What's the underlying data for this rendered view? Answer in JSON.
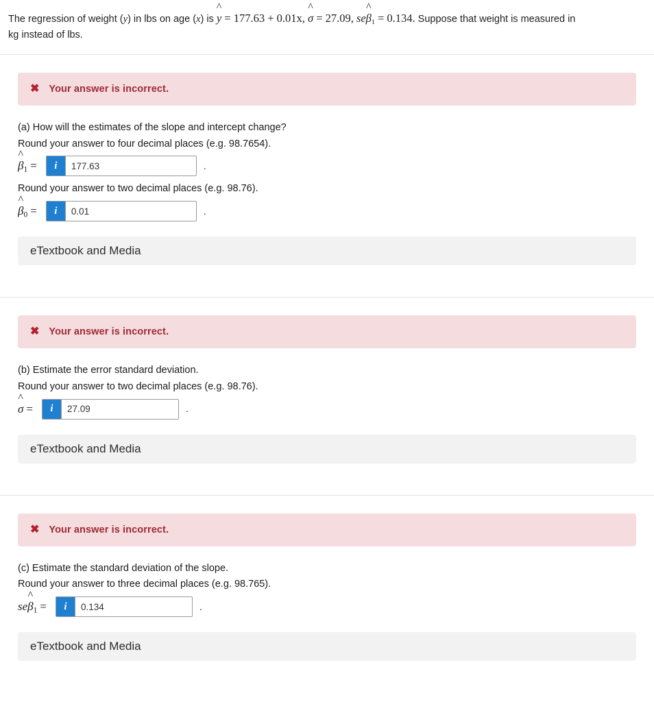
{
  "prompt": {
    "part1": "The regression of weight (",
    "y_var": "y",
    "part2": ") in lbs on age (",
    "x_var": "x",
    "part3": ") is ",
    "eq_yhat": "y",
    "eq_rest": " = 177.63 + 0.01x,",
    "sigma_hat": "σ",
    "sigma_val": " = 27.09,",
    "se_label": "se",
    "se_beta": "β",
    "se_sub": "1",
    "se_val": " = 0.134.",
    "part4": " Suppose that weight is measured in",
    "line2": "kg instead of lbs."
  },
  "sections": [
    {
      "alert": {
        "icon": "✖",
        "text": "Your answer is incorrect."
      },
      "question": "(a) How will the estimates of the slope and intercept change?",
      "instruction1": "Round your answer to four decimal places (e.g. 98.7654).",
      "answer1": {
        "symbol": "β",
        "sub": "1",
        "value": "177.63",
        "placeholder": "",
        "info_label": "i"
      },
      "instruction2": "Round your answer to two decimal places (e.g. 98.76).",
      "answer2": {
        "symbol": "β",
        "sub": "0",
        "value": "0.01",
        "placeholder": "",
        "info_label": "i"
      },
      "etextbook": "eTextbook and Media"
    },
    {
      "alert": {
        "icon": "✖",
        "text": "Your answer is incorrect."
      },
      "question": "(b) Estimate the error standard deviation.",
      "instruction1": "Round your answer to two decimal places (e.g. 98.76).",
      "answer1": {
        "symbol": "σ",
        "sub": "",
        "value": "27.09",
        "placeholder": "",
        "info_label": "i"
      },
      "etextbook": "eTextbook and Media"
    },
    {
      "alert": {
        "icon": "✖",
        "text": "Your answer is incorrect."
      },
      "question": "(c) Estimate the standard deviation of the slope.",
      "instruction1": "Round your answer to three decimal places (e.g. 98.765).",
      "answer1": {
        "symbol": "β",
        "sub": "1",
        "prefix": "se",
        "value": "0.134",
        "placeholder": "",
        "info_label": "i"
      },
      "etextbook": "eTextbook and Media"
    }
  ],
  "colors": {
    "alert_bg": "#f4dcdf",
    "alert_text": "#a02a35",
    "info_blue": "#1f7fd0",
    "etextbook_bg": "#f2f2f2"
  }
}
